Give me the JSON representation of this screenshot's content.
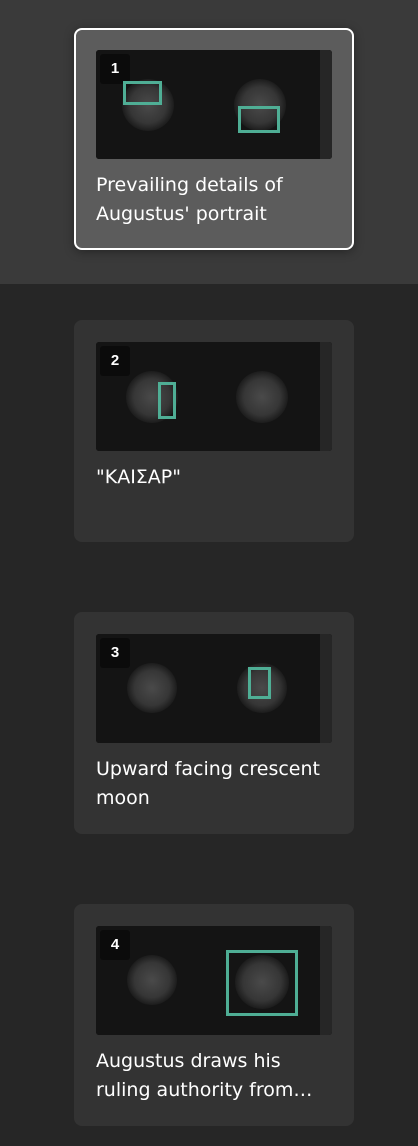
{
  "accent_color": "#4fae95",
  "cards": [
    {
      "number": "1",
      "caption": "Prevailing details of Augustus' portrait",
      "active": true
    },
    {
      "number": "2",
      "caption": "\"ΚΑΙΣΑΡ\"",
      "active": false
    },
    {
      "number": "3",
      "caption": "Upward facing crescent moon",
      "active": false
    },
    {
      "number": "4",
      "caption": "Augustus draws his ruling authority from…",
      "active": false
    }
  ]
}
